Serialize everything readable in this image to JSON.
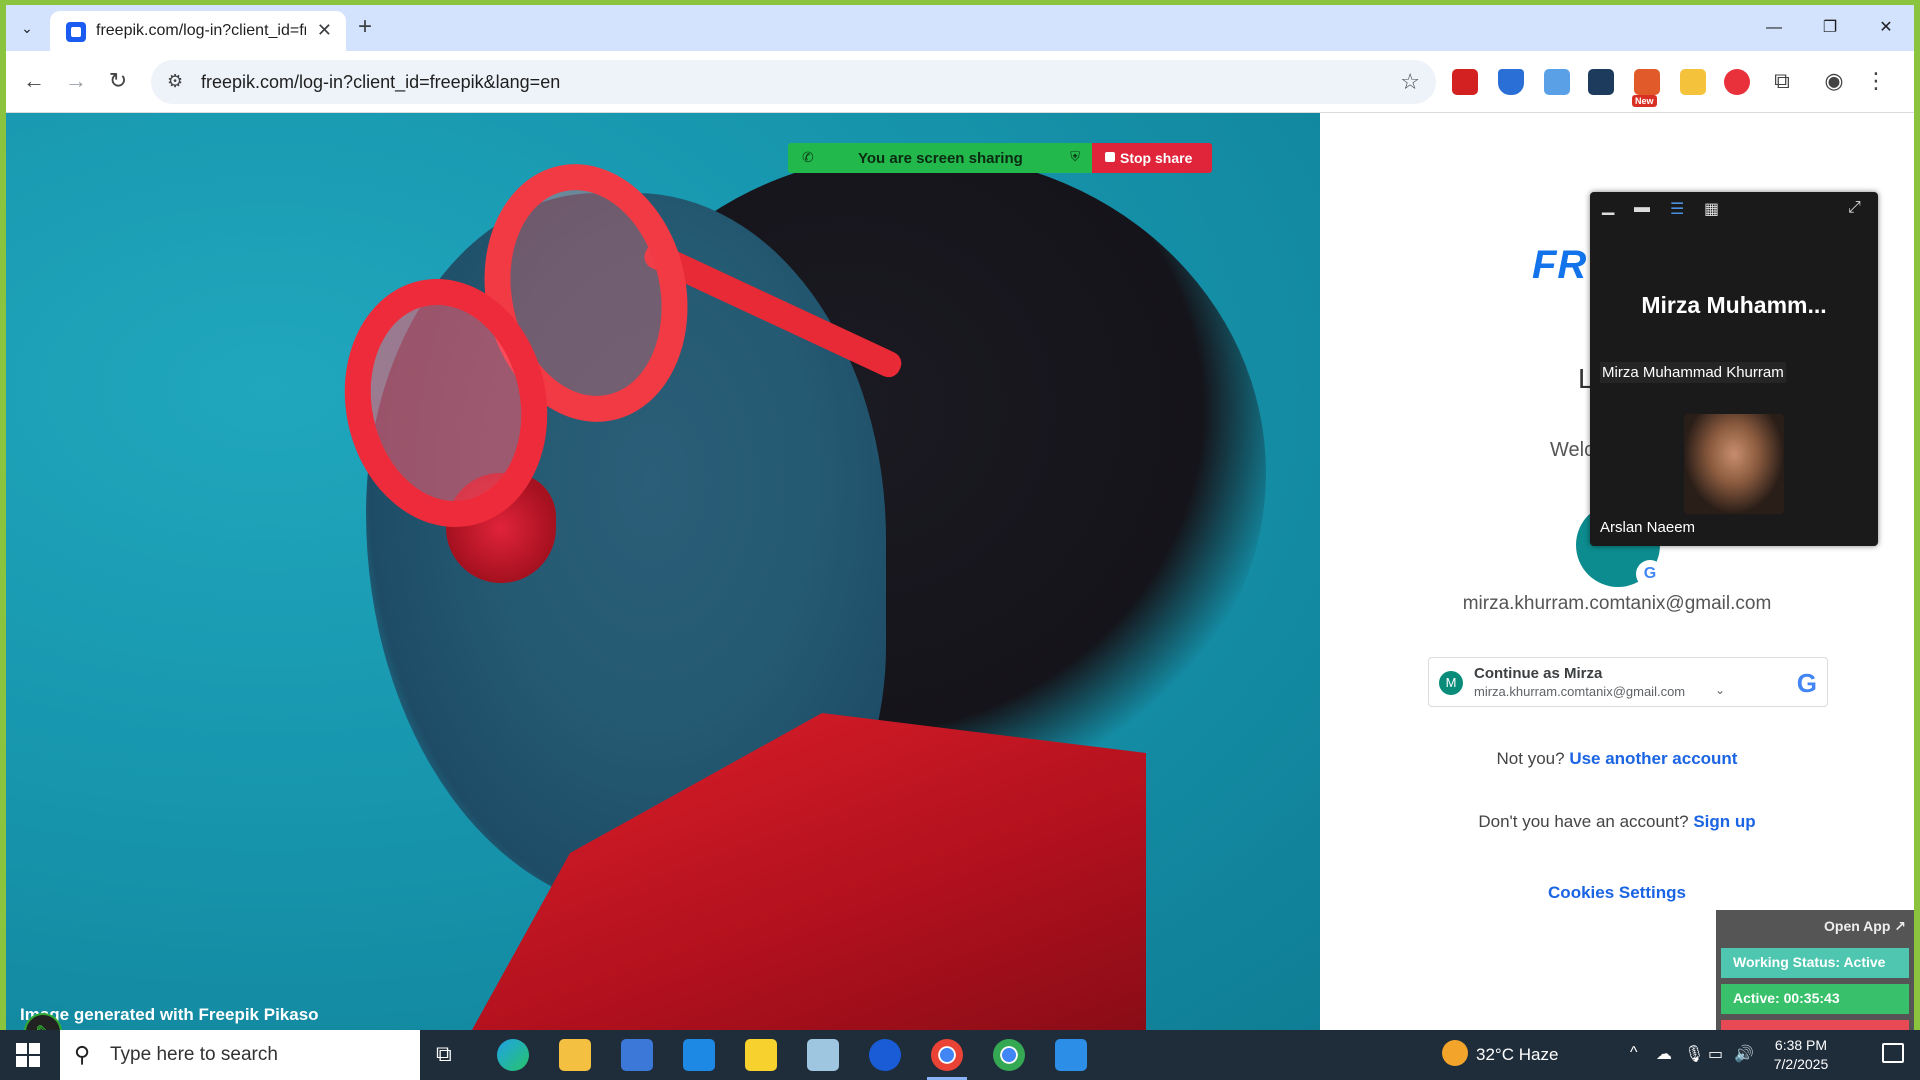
{
  "browser": {
    "tab": {
      "title": "freepik.com/log-in?client_id=fre",
      "close": "✕"
    },
    "new_tab": "+",
    "window_controls": {
      "minimize": "—",
      "maximize": "❐",
      "close": "✕"
    },
    "url": "freepik.com/log-in?client_id=freepik&lang=en",
    "extension_badge": "New"
  },
  "hero": {
    "caption": "Image generated with Freepik Pikaso"
  },
  "login": {
    "brand": "FR",
    "heading": "L",
    "welcome": "Welc",
    "avatar_letter": "M",
    "email": "mirza.khurram.comtanix@gmail.com",
    "google_button": {
      "avatar": "M",
      "name": "Continue as Mirza",
      "email": "mirza.khurram.comtanix@gmail.com"
    },
    "not_you": "Not you?",
    "use_another": "Use another account",
    "no_account": "Don't you have an account?",
    "sign_up": "Sign up",
    "cookies": "Cookies Settings"
  },
  "screen_share": {
    "status": "You are screen sharing",
    "stop": "Stop share",
    "colors": {
      "bar": "#23b84b",
      "stop": "#e0243a"
    }
  },
  "meeting": {
    "main_name": "Mirza  Muhamm...",
    "participant_1": "Mirza Muhammad Khurram",
    "participant_2": "Arslan Naeem"
  },
  "tracker": {
    "open_app": "Open App ↗",
    "working_status": "Working Status: Active",
    "active_time": "Active: 00:35:43"
  },
  "taskbar": {
    "search_placeholder": "Type here to search",
    "weather": "32°C  Haze",
    "time": "6:38 PM",
    "date": "7/2/2025"
  }
}
